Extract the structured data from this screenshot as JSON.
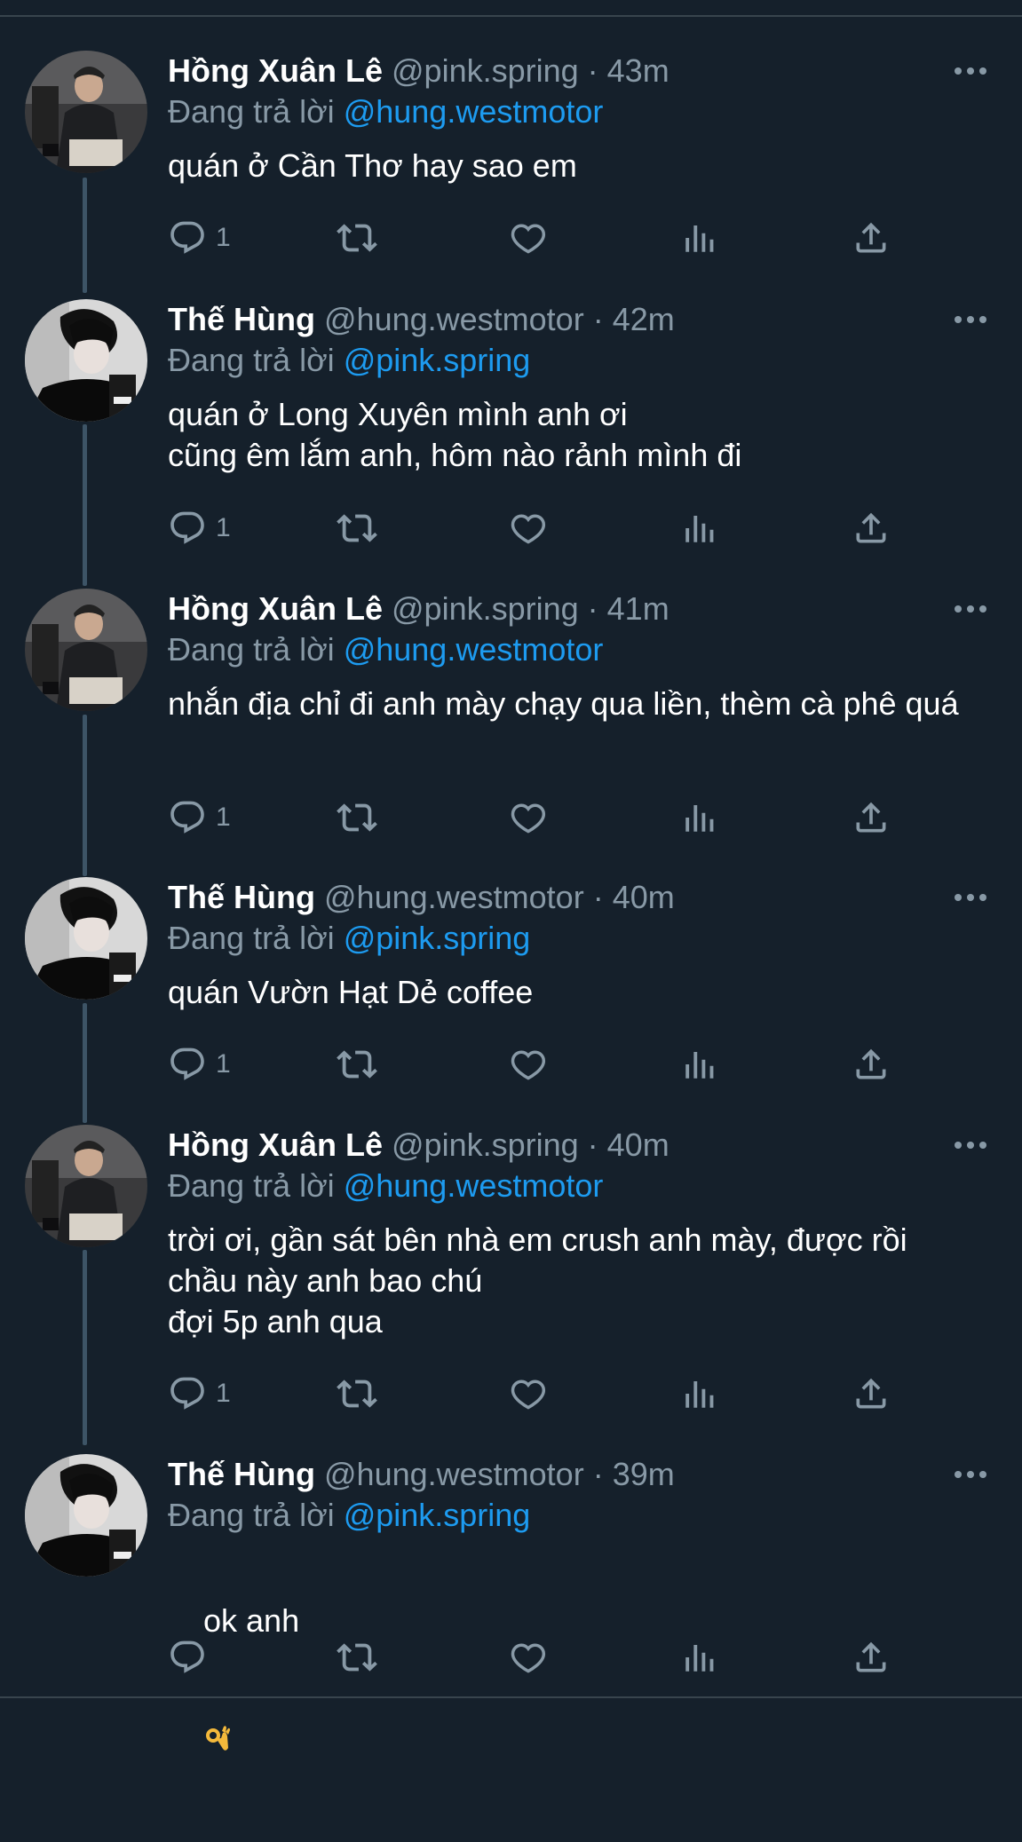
{
  "icons": {
    "reply": "reply-icon",
    "retweet": "retweet-icon",
    "like": "heart-icon",
    "views": "bar-chart-icon",
    "share": "share-icon",
    "more": "more-icon"
  },
  "colors": {
    "background": "#15202b",
    "secondary_text": "#8899a6",
    "link": "#1d9bf0",
    "thread_line": "#3d5466"
  },
  "tweets": [
    {
      "name": "Hồng Xuân Lê",
      "handle": "@pink.spring",
      "dot": " · ",
      "time": "43m",
      "reply_prefix": "Đang trả lời ",
      "reply_target": "@hung.westmotor",
      "text": "quán ở Cần Thơ hay sao em",
      "reply_count": "1"
    },
    {
      "name": "Thế Hùng",
      "handle": "@hung.westmotor",
      "dot": " · ",
      "time": "42m",
      "reply_prefix": "Đang trả lời ",
      "reply_target": "@pink.spring",
      "text": "quán ở Long Xuyên mình anh ơi\ncũng êm lắm anh, hôm nào rảnh mình đi",
      "reply_count": "1"
    },
    {
      "name": "Hồng Xuân Lê",
      "handle": "@pink.spring",
      "dot": " · ",
      "time": "41m",
      "reply_prefix": "Đang trả lời ",
      "reply_target": "@hung.westmotor",
      "text": "nhắn địa chỉ đi anh mày chạy qua liền, thèm cà phê quá",
      "reply_count": "1"
    },
    {
      "name": "Thế Hùng",
      "handle": "@hung.westmotor",
      "dot": " · ",
      "time": "40m",
      "reply_prefix": "Đang trả lời ",
      "reply_target": "@pink.spring",
      "text": "quán Vườn Hạt Dẻ coffee",
      "reply_count": "1"
    },
    {
      "name": "Hồng Xuân Lê",
      "handle": "@pink.spring",
      "dot": " · ",
      "time": "40m",
      "reply_prefix": "Đang trả lời ",
      "reply_target": "@hung.westmotor",
      "text": "trời ơi, gần sát bên nhà em crush anh mày, được rồi\nchầu này anh bao chú\nđợi 5p anh qua",
      "reply_count": "1"
    },
    {
      "name": "Thế Hùng",
      "handle": "@hung.westmotor",
      "dot": " · ",
      "time": "39m",
      "reply_prefix": "Đang trả lời ",
      "reply_target": "@pink.spring",
      "text": "ok anh",
      "emoji": "ok-hand-emoji",
      "reply_count": ""
    }
  ]
}
